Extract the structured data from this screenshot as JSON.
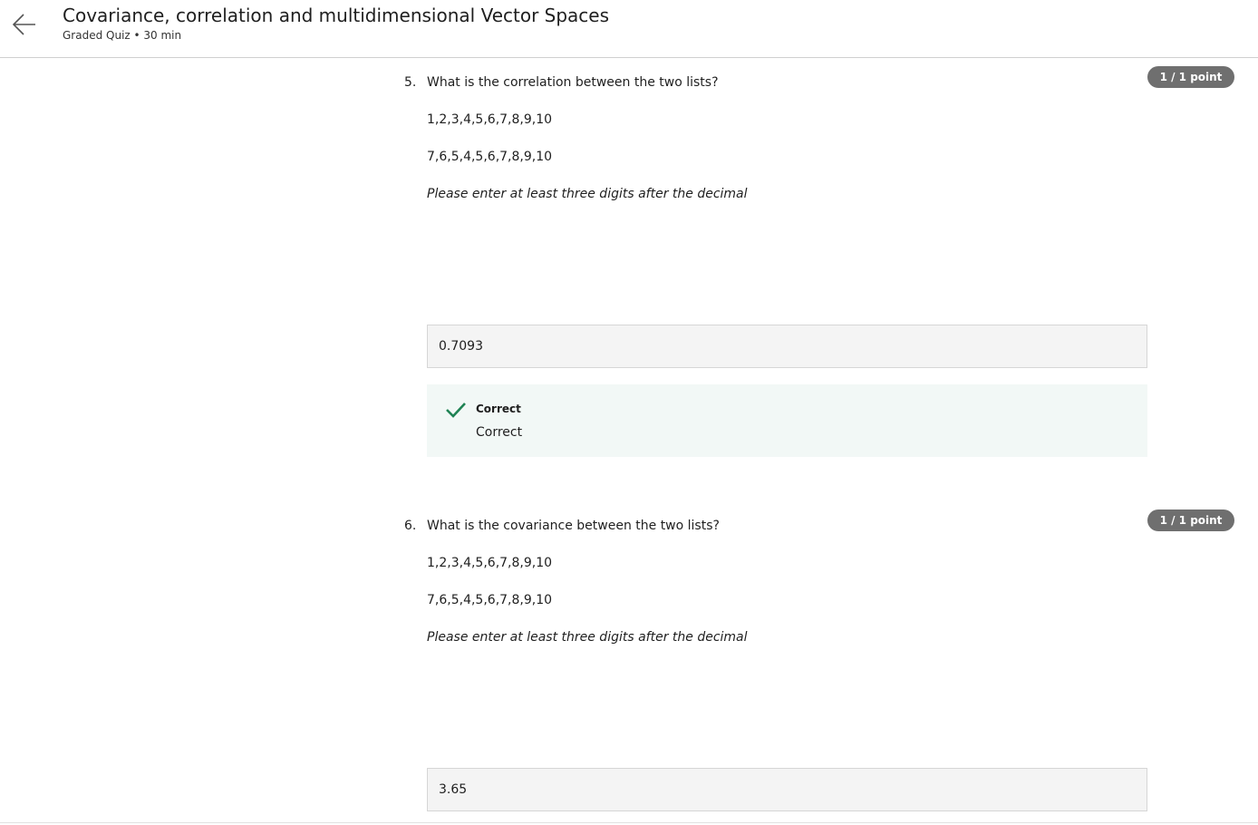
{
  "header": {
    "title": "Covariance, correlation and multidimensional Vector Spaces",
    "subtitle": "Graded Quiz • 30 min",
    "back_icon": "arrow-left-icon"
  },
  "questions": [
    {
      "number": "5.",
      "text": "What is the correlation between the two lists?",
      "points": "1 / 1 point",
      "list1": "1,2,3,4,5,6,7,8,9,10",
      "list2": "7,6,5,4,5,6,7,8,9,10",
      "note": "Please enter at least three digits after the decimal",
      "answer": "0.7093",
      "feedback": {
        "title": "Correct",
        "text": "Correct",
        "icon": "checkmark-icon"
      }
    },
    {
      "number": "6.",
      "text": "What is the covariance between the two lists?",
      "points": "1 / 1 point",
      "list1": "1,2,3,4,5,6,7,8,9,10",
      "list2": "7,6,5,4,5,6,7,8,9,10",
      "note": "Please enter at least three digits after the decimal",
      "answer": "3.65"
    }
  ],
  "colors": {
    "accent_green": "#1f8354",
    "points_badge": "#6f6f6f",
    "feedback_bg": "#f2f8f6"
  }
}
